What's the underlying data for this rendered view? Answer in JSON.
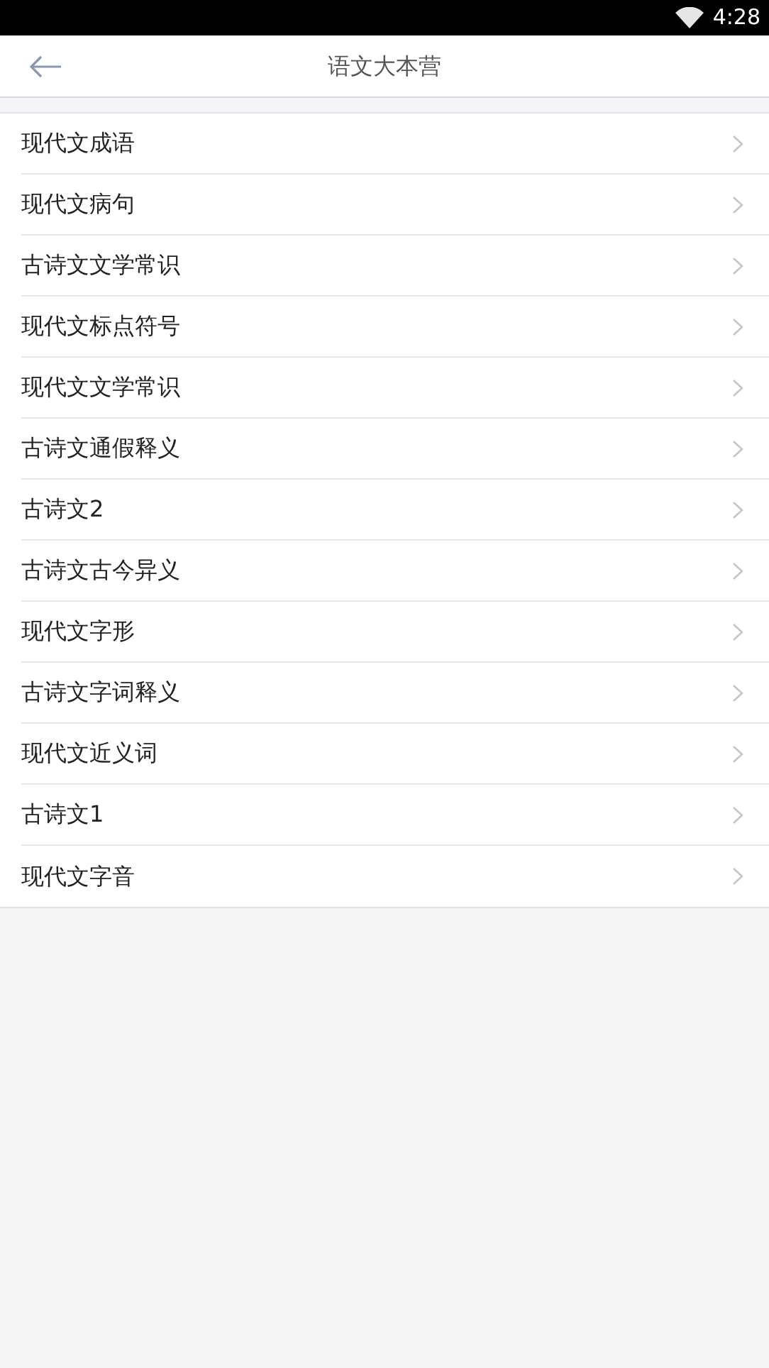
{
  "status_bar": {
    "time": "4:28"
  },
  "header": {
    "title": "语文大本营"
  },
  "items": [
    {
      "label": "现代文成语"
    },
    {
      "label": "现代文病句"
    },
    {
      "label": "古诗文文学常识"
    },
    {
      "label": "现代文标点符号"
    },
    {
      "label": "现代文文学常识"
    },
    {
      "label": "古诗文通假释义"
    },
    {
      "label": "古诗文2"
    },
    {
      "label": "古诗文古今异义"
    },
    {
      "label": "现代文字形"
    },
    {
      "label": "古诗文字词释义"
    },
    {
      "label": "现代文近义词"
    },
    {
      "label": "古诗文1"
    },
    {
      "label": "现代文字音"
    }
  ]
}
